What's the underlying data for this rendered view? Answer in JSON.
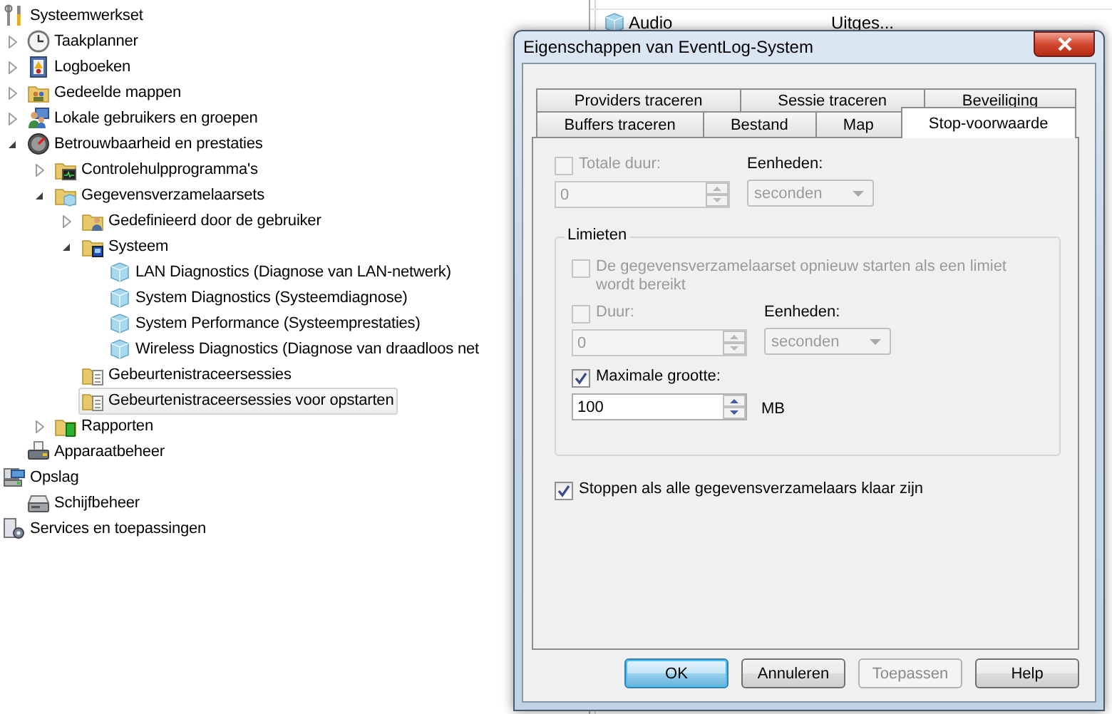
{
  "tree": {
    "items": [
      {
        "label": "Systeemwerkset",
        "kind": "tools",
        "selected": false,
        "children": [
          {
            "label": "Taakplanner",
            "kind": "clock",
            "expanded": false,
            "selected": false
          },
          {
            "label": "Logboeken",
            "kind": "logbook",
            "expanded": false,
            "selected": false
          },
          {
            "label": "Gedeelde mappen",
            "kind": "shared-folder",
            "expanded": false,
            "selected": false
          },
          {
            "label": "Lokale gebruikers en groepen",
            "kind": "users",
            "expanded": false,
            "selected": false
          },
          {
            "label": "Betrouwbaarheid en prestaties",
            "kind": "gauge",
            "expanded": true,
            "selected": false,
            "children": [
              {
                "label": "Controlehulpprogramma's",
                "kind": "monitor-folder",
                "expanded": false,
                "selected": false
              },
              {
                "label": "Gegevensverzamelaarsets",
                "kind": "data-folder",
                "expanded": true,
                "selected": false,
                "children": [
                  {
                    "label": "Gedefinieerd door de gebruiker",
                    "kind": "user-folder",
                    "expanded": false,
                    "selected": false
                  },
                  {
                    "label": "Systeem",
                    "kind": "system-folder",
                    "expanded": true,
                    "selected": false,
                    "children": [
                      {
                        "label": "LAN Diagnostics (Diagnose van LAN-netwerk)",
                        "kind": "collector",
                        "selected": false
                      },
                      {
                        "label": "System Diagnostics (Systeemdiagnose)",
                        "kind": "collector",
                        "selected": false
                      },
                      {
                        "label": "System Performance (Systeemprestaties)",
                        "kind": "collector",
                        "selected": false
                      },
                      {
                        "label": "Wireless Diagnostics (Diagnose van draadloos net",
                        "kind": "collector",
                        "selected": false
                      }
                    ]
                  },
                  {
                    "label": "Gebeurtenistraceersessies",
                    "kind": "trace-folder",
                    "selected": false
                  },
                  {
                    "label": "Gebeurtenistraceersessies voor opstarten",
                    "kind": "trace-folder",
                    "selected": true
                  }
                ]
              },
              {
                "label": "Rapporten",
                "kind": "report-folder",
                "expanded": false,
                "selected": false
              }
            ]
          },
          {
            "label": "Apparaatbeheer",
            "kind": "device",
            "selected": false
          }
        ]
      },
      {
        "label": "Opslag",
        "kind": "storage",
        "selected": false,
        "children": [
          {
            "label": "Schijfbeheer",
            "kind": "disk",
            "selected": false
          }
        ]
      },
      {
        "label": "Services en toepassingen",
        "kind": "services",
        "selected": false
      }
    ]
  },
  "background_list": {
    "rows": [
      {
        "cells": [
          "Audio",
          "Uitges..."
        ]
      }
    ]
  },
  "dialog": {
    "title": "Eigenschappen van EventLog-System",
    "tab_rows": [
      [
        {
          "label": "Providers traceren",
          "selected": false
        },
        {
          "label": "Sessie traceren",
          "selected": false
        },
        {
          "label": "Beveiliging",
          "selected": false
        }
      ],
      [
        {
          "label": "Buffers traceren",
          "selected": false
        },
        {
          "label": "Bestand",
          "selected": false
        },
        {
          "label": "Map",
          "selected": false
        },
        {
          "label": "Stop-voorwaarde",
          "selected": true
        }
      ]
    ],
    "total_duration": {
      "label": "Totale duur:",
      "checked": false,
      "disabled": true,
      "value": "0"
    },
    "total_units": {
      "label": "Eenheden:",
      "value": "seconden",
      "disabled": true
    },
    "limits": {
      "title": "Limieten",
      "restart": {
        "label": "De gegevensverzamelaarset opnieuw starten als een limiet wordt bereikt",
        "checked": false,
        "disabled": true
      },
      "duration": {
        "label": "Duur:",
        "checked": false,
        "disabled": true,
        "value": "0"
      },
      "units": {
        "label": "Eenheden:",
        "value": "seconden",
        "disabled": true
      },
      "max_size": {
        "label": "Maximale grootte:",
        "checked": true,
        "disabled": false,
        "value": "100",
        "unit": "MB"
      }
    },
    "stop_when_done": {
      "label": "Stoppen als alle gegevensverzamelaars klaar zijn",
      "checked": true,
      "disabled": false
    },
    "buttons": [
      {
        "label": "OK",
        "default": true,
        "disabled": false
      },
      {
        "label": "Annuleren",
        "default": false,
        "disabled": false
      },
      {
        "label": "Toepassen",
        "default": false,
        "disabled": true
      },
      {
        "label": "Help",
        "default": false,
        "disabled": false
      }
    ]
  }
}
